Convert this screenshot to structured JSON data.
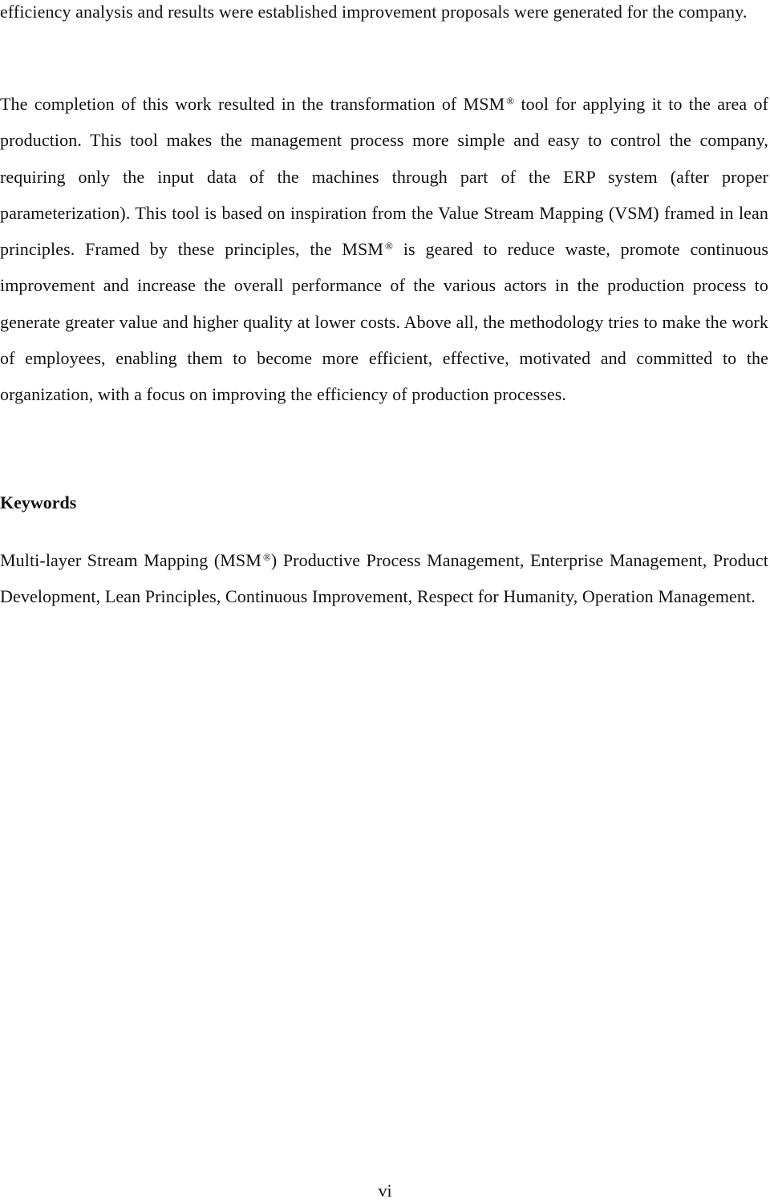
{
  "document": {
    "paragraphs": [
      {
        "id": "p1",
        "text": "efficiency analysis and results were established improvement proposals were generated for the company."
      },
      {
        "id": "p2",
        "segments": [
          "The completion of this work resulted in the transformation of MSM",
          " tool for applying it to the area of production. This tool makes the management process more simple and easy to control the company, requiring only the input data of the machines through part of the ERP system (after proper parameterization). This tool is based on inspiration from the Value Stream Mapping (VSM) framed in lean principles. Framed by these principles, the MSM",
          " is geared to reduce waste, promote continuous improvement and increase the overall performance of the various actors in the production process to generate greater value and higher quality at lower costs. Above all, the methodology tries to make the work of employees, enabling them to become more efficient, effective, motivated and committed to the organization, with a focus on improving the efficiency of production processes."
        ]
      }
    ],
    "registered_mark": "®",
    "keywords_heading": "Keywords",
    "keywords": {
      "segments": [
        "Multi-layer Stream Mapping (MSM",
        ") Productive Process Management, Enterprise Management, Product Development, Lean Principles, Continuous Improvement, Respect for Humanity, Operation Management."
      ]
    },
    "page_number": "vi"
  }
}
